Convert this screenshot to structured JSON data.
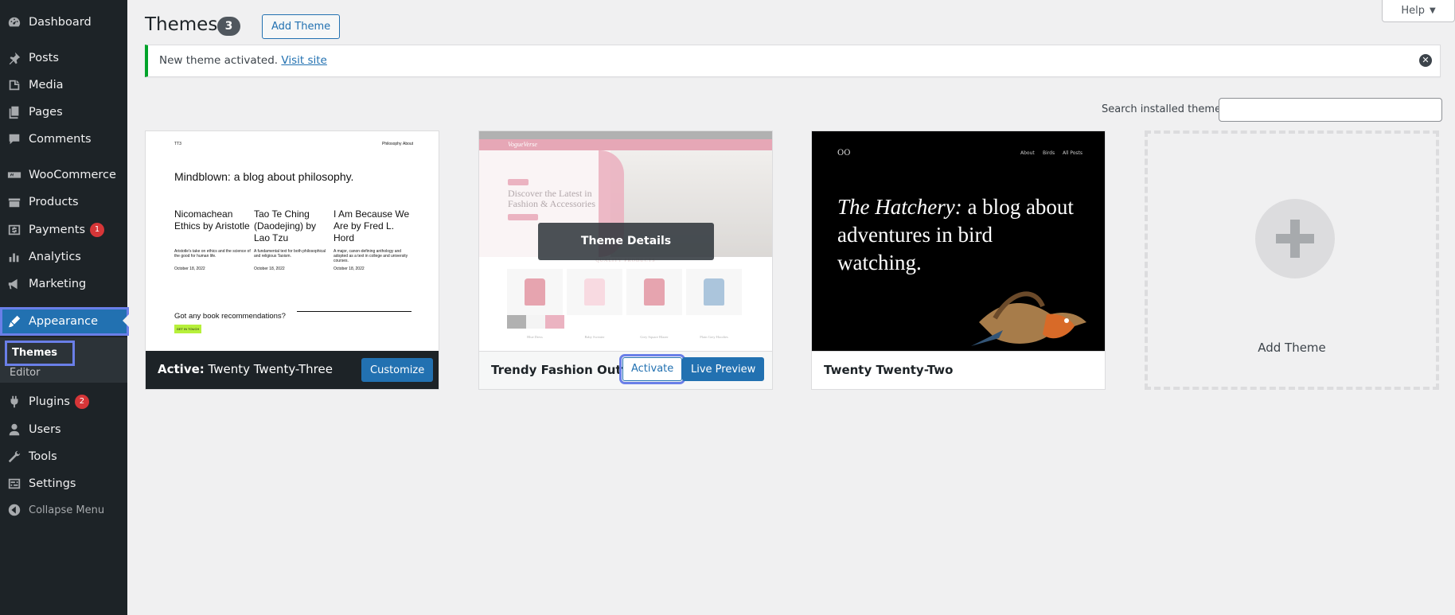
{
  "sidebar": {
    "items": [
      {
        "label": "Dashboard",
        "icon": "dashboard-icon"
      },
      {
        "label": "Posts",
        "icon": "pin-icon"
      },
      {
        "label": "Media",
        "icon": "media-icon"
      },
      {
        "label": "Pages",
        "icon": "pages-icon"
      },
      {
        "label": "Comments",
        "icon": "comments-icon"
      },
      {
        "label": "WooCommerce",
        "icon": "woocommerce-icon"
      },
      {
        "label": "Products",
        "icon": "products-icon"
      },
      {
        "label": "Payments",
        "icon": "payments-icon",
        "badge": "1"
      },
      {
        "label": "Analytics",
        "icon": "analytics-icon"
      },
      {
        "label": "Marketing",
        "icon": "marketing-icon"
      },
      {
        "label": "Appearance",
        "icon": "appearance-icon"
      },
      {
        "label": "Plugins",
        "icon": "plugins-icon",
        "badge": "2"
      },
      {
        "label": "Users",
        "icon": "users-icon"
      },
      {
        "label": "Tools",
        "icon": "tools-icon"
      },
      {
        "label": "Settings",
        "icon": "settings-icon"
      },
      {
        "label": "Collapse Menu",
        "icon": "collapse-icon"
      }
    ],
    "submenu": {
      "themes": "Themes",
      "editor": "Editor"
    }
  },
  "header": {
    "title": "Themes",
    "count": "3",
    "add_theme": "Add Theme",
    "help": "Help"
  },
  "notice": {
    "text": "New theme activated.",
    "link": "Visit site"
  },
  "search": {
    "label": "Search installed themes",
    "value": ""
  },
  "themes": [
    {
      "active_prefix": "Active:",
      "name": "Twenty Twenty-Three",
      "action": "Customize",
      "preview": {
        "logo": "TT3",
        "nav": [
          "Philosophy",
          "About"
        ],
        "headline": "Mindblown: a blog about philosophy.",
        "posts": [
          {
            "title": "Nicomachean Ethics by Aristotle",
            "desc": "Aristotle's take on ethics and the science of the good for human life.",
            "date": "October 18, 2022"
          },
          {
            "title": "Tao Te Ching (Daodejing) by Lao Tzu",
            "desc": "A fundamental text for both philosophical and religious Taoism.",
            "date": "October 18, 2022"
          },
          {
            "title": "I Am Because We Are by Fred L. Hord",
            "desc": "A major, canon-defining anthology and adopted as a text in college and university courses.",
            "date": "October 18, 2022"
          }
        ],
        "question": "Got any book recommendations?",
        "cta": "GET IN TOUCH"
      }
    },
    {
      "name": "Trendy Fashion Outfits",
      "details": "Theme Details",
      "activate": "Activate",
      "live_preview": "Live Preview",
      "preview": {
        "brand": "VogueVerse",
        "hero": "Discover the Latest in Fashion & Accessories",
        "section": "QUALITY PRODUCTS",
        "products": [
          "Blue Dress",
          "Baby Sweater",
          "Grey Square Blazer",
          "Plain Grey Hoodies"
        ]
      }
    },
    {
      "name": "Twenty Twenty-Two",
      "preview": {
        "logo": "OO",
        "nav": [
          "About",
          "Birds",
          "All Posts"
        ],
        "title_italic": "The Hatchery:",
        "title_rest": " a blog about adventures in bird watching."
      }
    }
  ],
  "add_card": {
    "label": "Add Theme"
  },
  "colors": {
    "sidebar": "#1d2327",
    "accent": "#2271b1",
    "badge": "#d63638",
    "notice_border": "#00a32a",
    "highlight": "#6a7fe8"
  }
}
